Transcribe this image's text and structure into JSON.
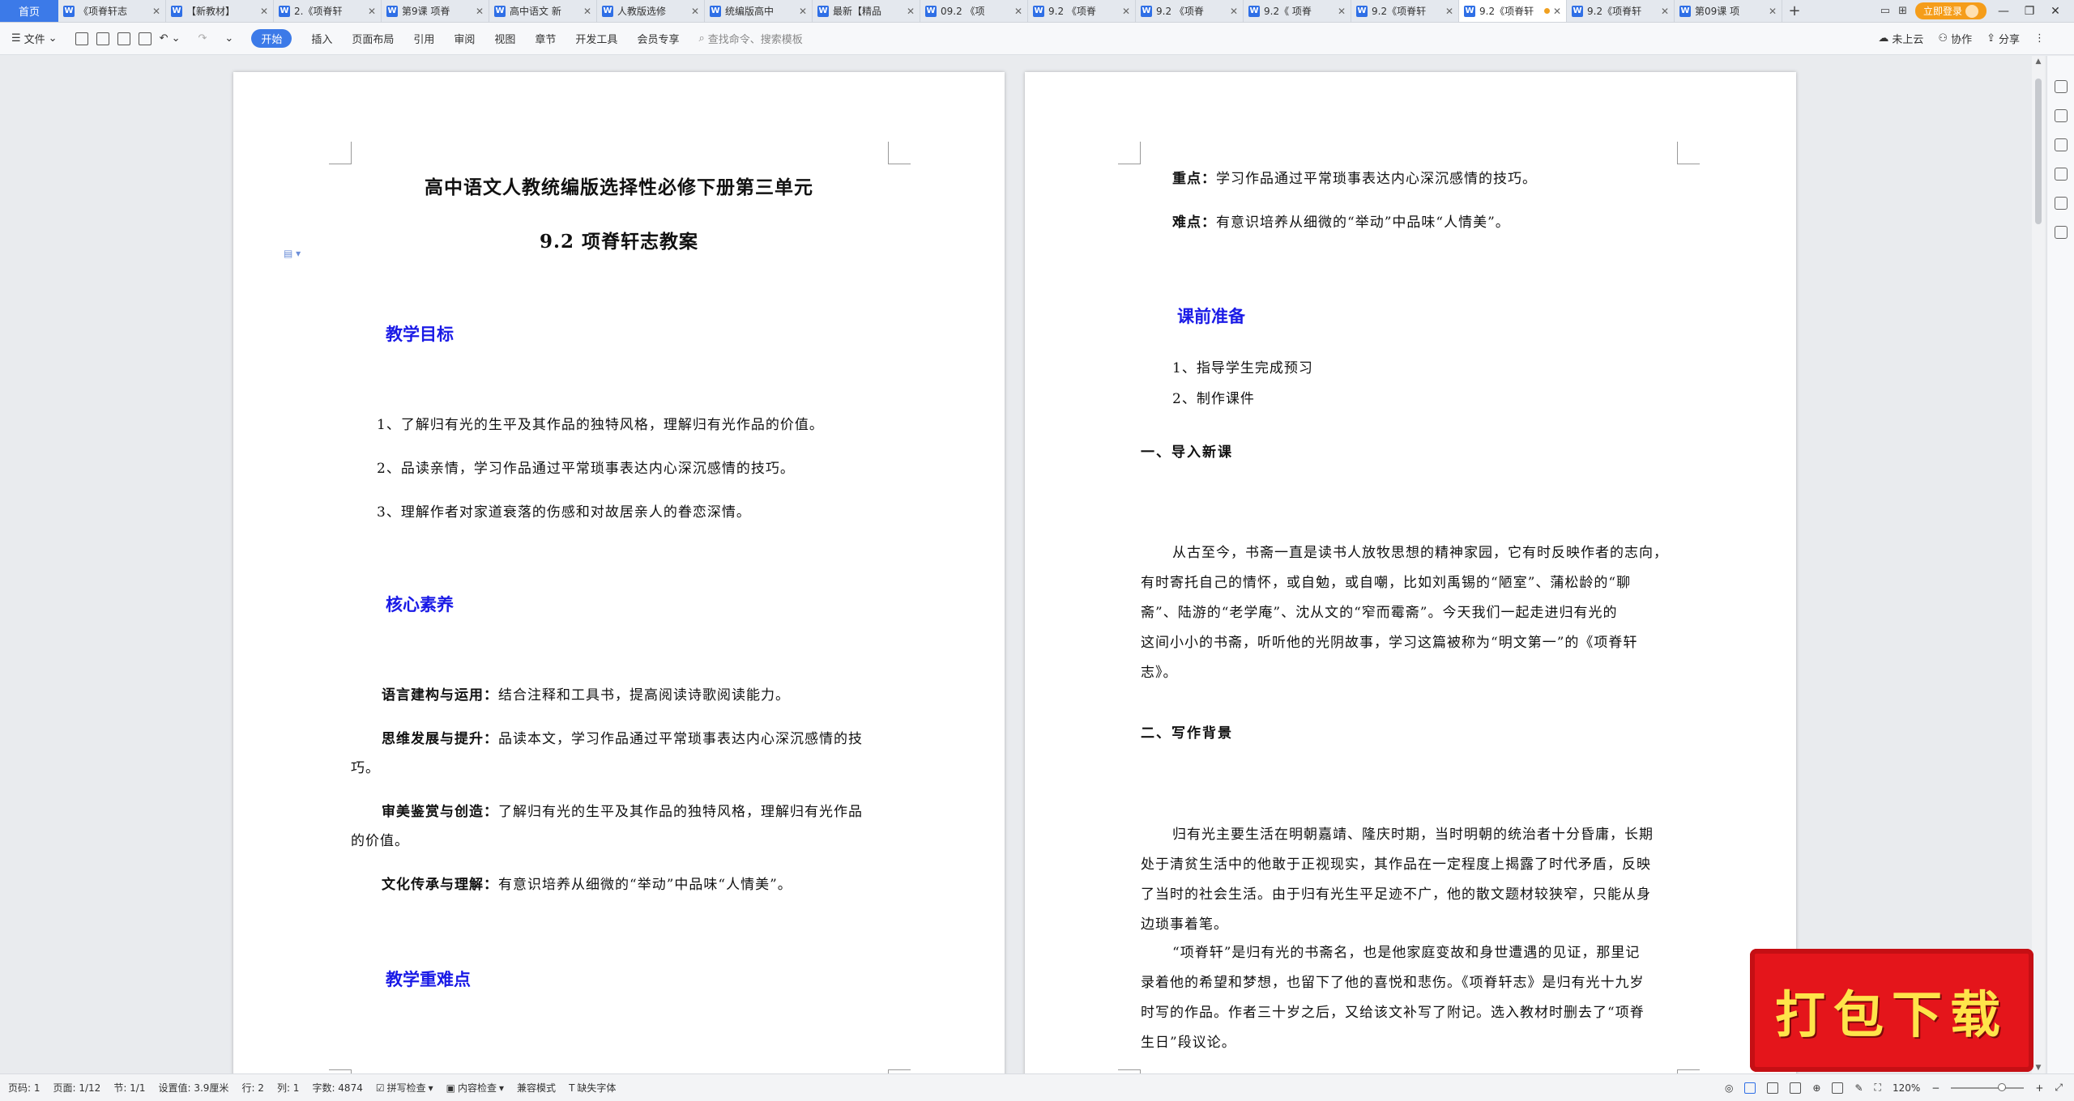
{
  "tabbar": {
    "home_label": "首页",
    "tabs": [
      {
        "title": "《项脊轩志",
        "active": false
      },
      {
        "title": "【新教材】",
        "active": false
      },
      {
        "title": "2.《项脊轩",
        "active": false
      },
      {
        "title": "第9课 项脊",
        "active": false
      },
      {
        "title": "高中语文 新",
        "active": false
      },
      {
        "title": "人教版选修",
        "active": false
      },
      {
        "title": "统编版高中",
        "active": false
      },
      {
        "title": "最新【精品",
        "active": false
      },
      {
        "title": "09.2 《项",
        "active": false
      },
      {
        "title": "9.2 《项脊",
        "active": false
      },
      {
        "title": "9.2 《项脊",
        "active": false
      },
      {
        "title": "9.2《 项脊",
        "active": false
      },
      {
        "title": "9.2《项脊轩",
        "active": false
      },
      {
        "title": "9.2《项脊轩",
        "active": true
      },
      {
        "title": "9.2《项脊轩",
        "active": false
      },
      {
        "title": "第09课 项",
        "active": false
      }
    ],
    "login_label": "立即登录"
  },
  "ribbon": {
    "file_label": "文件",
    "tabs": [
      "开始",
      "插入",
      "页面布局",
      "引用",
      "审阅",
      "视图",
      "章节",
      "开发工具",
      "会员专享"
    ],
    "active_tab": "开始",
    "search_placeholder": "查找命令、搜索模板",
    "cloud_label": "未上云",
    "collab_label": "协作",
    "share_label": "分享"
  },
  "page1": {
    "title_line1": "高中语文人教统编版选择性必修下册第三单元",
    "title_line2": "9.2 项脊轩志教案",
    "sec_goals": "教学目标",
    "goals": [
      "1、了解归有光的生平及其作品的独特风格，理解归有光作品的价值。",
      "2、品读亲情，学习作品通过平常琐事表达内心深沉感情的技巧。",
      "3、理解作者对家道衰落的伤感和对故居亲人的眷恋深情。"
    ],
    "sec_core": "核心素养",
    "core": [
      {
        "label": "语言建构与运用：",
        "text_1": "结合注释和工具书，提高阅读诗歌阅读能力。",
        "text_2": ""
      },
      {
        "label": "思维发展与提升：",
        "text_1": "品读本文，学习作品通过平常琐事表达内心深沉感情的技",
        "text_2": "巧。"
      },
      {
        "label": "审美鉴赏与创造：",
        "text_1": "了解归有光的生平及其作品的独特风格，理解归有光作品",
        "text_2": "的价值。"
      },
      {
        "label": "文化传承与理解：",
        "text_1": "有意识培养从细微的“举动”中品味“人情美”。",
        "text_2": ""
      }
    ],
    "sec_key": "教学重难点"
  },
  "page2": {
    "key_label": "重点：",
    "key_text": "学习作品通过平常琐事表达内心深沉感情的技巧。",
    "diff_label": "难点：",
    "diff_text": "有意识培养从细微的“举动”中品味“人情美”。",
    "sec_prep": "课前准备",
    "prep": [
      "1、指导学生完成预习",
      "2、制作课件"
    ],
    "sec_intro": "一、导入新课",
    "intro_lines": [
      "从古至今，书斋一直是读书人放牧思想的精神家园，它有时反映作者的志向，",
      "有时寄托自己的情怀，或自勉，或自嘲，比如刘禹锡的“陋室”、蒲松龄的“聊",
      "斋”、陆游的“老学庵”、沈从文的“窄而霉斋”。今天我们一起走进归有光的",
      "这间小小的书斋，听听他的光阴故事，学习这篇被称为“明文第一”的《项脊轩",
      "志》。"
    ],
    "sec_bg": "二、写作背景",
    "bg_lines": [
      "归有光主要生活在明朝嘉靖、隆庆时期，当时明朝的统治者十分昏庸，长期",
      "处于清贫生活中的他敢于正视现实，其作品在一定程度上揭露了时代矛盾，反映",
      "了当时的社会生活。由于归有光生平足迹不广，他的散文题材较狭窄，只能从身",
      "边琐事着笔。"
    ],
    "bg2_lines": [
      "“项脊轩”是归有光的书斋名，也是他家庭变故和身世遭遇的见证，那里记",
      "录着他的希望和梦想，也留下了他的喜悦和悲伤。《项脊轩志》是归有光十九岁",
      "时写的作品。作者三十岁之后，又给该文补写了附记。选入教材时删去了“项脊",
      "生日”段议论。"
    ]
  },
  "statusbar": {
    "page_no": "页码: 1",
    "pages": "页面: 1/12",
    "section": "节: 1/1",
    "setting": "设置值: 3.9厘米",
    "row": "行: 2",
    "col": "列: 1",
    "words": "字数: 4874",
    "spell": "拼写检查",
    "content_check": "内容检查",
    "compat": "兼容模式",
    "missing_font": "缺失字体",
    "zoom": "120%"
  },
  "badge": {
    "text": "打包下载"
  }
}
